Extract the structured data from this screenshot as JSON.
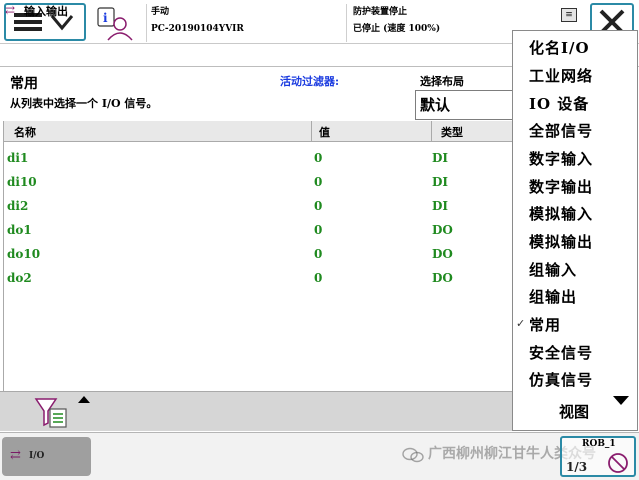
{
  "status": {
    "mode": "手动",
    "controller": "PC-20190104YVIR",
    "state_title": "防护装置停止",
    "state_detail": "已停止 (速度 100%)"
  },
  "app": {
    "title": "输入输出"
  },
  "filter": {
    "section_title": "常用",
    "description": "从列表中选择一个 I/O 信号。",
    "active_filter_label": "活动过滤器:",
    "layout_label": "选择布局",
    "layout_value": "默认"
  },
  "table": {
    "columns": [
      "名称",
      "值",
      "类型"
    ],
    "rows": [
      {
        "name": "di1",
        "value": "0",
        "type": "DI"
      },
      {
        "name": "di10",
        "value": "0",
        "type": "DI"
      },
      {
        "name": "di2",
        "value": "0",
        "type": "DI"
      },
      {
        "name": "do1",
        "value": "0",
        "type": "DO"
      },
      {
        "name": "do10",
        "value": "0",
        "type": "DO"
      },
      {
        "name": "do2",
        "value": "0",
        "type": "DO"
      }
    ]
  },
  "menu": {
    "items": [
      {
        "label": "化名I/O",
        "checked": false
      },
      {
        "label": "工业网络",
        "checked": false
      },
      {
        "label": "IO 设备",
        "checked": false
      },
      {
        "label": "全部信号",
        "checked": false
      },
      {
        "label": "数字输入",
        "checked": false
      },
      {
        "label": "数字输出",
        "checked": false
      },
      {
        "label": "模拟输入",
        "checked": false
      },
      {
        "label": "模拟输出",
        "checked": false
      },
      {
        "label": "组输入",
        "checked": false
      },
      {
        "label": "组输出",
        "checked": false
      },
      {
        "label": "常用",
        "checked": true
      },
      {
        "label": "安全信号",
        "checked": false
      },
      {
        "label": "仿真信号",
        "checked": false
      }
    ],
    "check_glyph": "✓",
    "view_label": "视图"
  },
  "taskbar": {
    "io_label": "I/O",
    "watermark": "广西柳州柳江甘牛人类众号",
    "speed_label": "ROB_1",
    "speed_fraction": "1/3"
  },
  "colors": {
    "accent": "#2b8aa6",
    "signal_text": "#1f8a1f",
    "filter_label": "#1c3ce0",
    "io_icon": "#8a1d6e"
  },
  "icons": [
    "menu-icon",
    "chevron-down-icon",
    "user-info-icon",
    "status-icon",
    "close-icon",
    "io-icon",
    "filter-icon",
    "up-arrow-icon",
    "down-arrow-icon",
    "wechat-icon",
    "speed-icon"
  ]
}
